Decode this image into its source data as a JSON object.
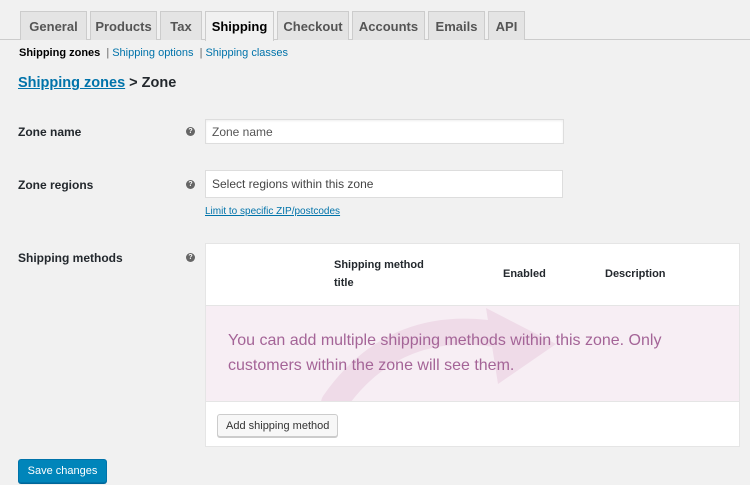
{
  "tabs": [
    {
      "label": "General",
      "active": false
    },
    {
      "label": "Products",
      "active": false
    },
    {
      "label": "Tax",
      "active": false
    },
    {
      "label": "Shipping",
      "active": true
    },
    {
      "label": "Checkout",
      "active": false
    },
    {
      "label": "Accounts",
      "active": false
    },
    {
      "label": "Emails",
      "active": false
    },
    {
      "label": "API",
      "active": false
    }
  ],
  "subnav": {
    "current": "Shipping zones",
    "separator": "|",
    "options": "Shipping options",
    "classes": "Shipping classes"
  },
  "heading": {
    "link": "Shipping zones",
    "rest": "> Zone"
  },
  "form": {
    "zone_name": {
      "label": "Zone name",
      "placeholder": "Zone name",
      "value": ""
    },
    "zone_regions": {
      "label": "Zone regions",
      "placeholder": "Select regions within this zone",
      "limit_link": "Limit to specific ZIP/postcodes"
    },
    "shipping_methods": {
      "label": "Shipping methods",
      "columns": [
        "Shipping method title",
        "Enabled",
        "Description"
      ],
      "blank_message": "You can add multiple shipping methods within this zone. Only customers within the zone will see them.",
      "add_button": "Add shipping method"
    },
    "help_icon": "?"
  },
  "save_button": "Save changes",
  "colors": {
    "link": "#0073aa",
    "primary_button": "#0085ba",
    "blank_bg": "#f7eef4",
    "blank_text": "#a46497"
  },
  "icons": {
    "help": "help-tip-icon",
    "watermark": "shipping-arrow-icon"
  }
}
